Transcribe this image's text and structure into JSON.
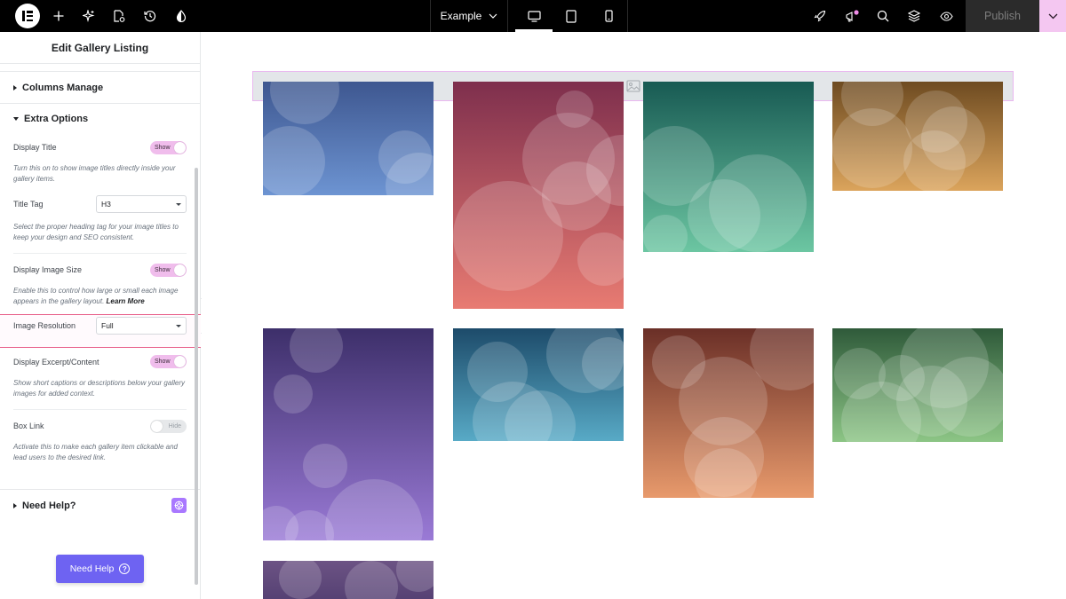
{
  "topbar": {
    "site_name": "Example",
    "publish_label": "Publish",
    "icons": [
      "elementor-logo-icon",
      "plus-icon",
      "sparkle-icon",
      "page-settings-icon",
      "history-icon",
      "theme-style-icon",
      "desktop-icon",
      "tablet-icon",
      "mobile-icon",
      "launch-icon",
      "notifications-icon",
      "search-icon",
      "structure-icon",
      "preview-icon",
      "chevron-down-icon"
    ]
  },
  "panel": {
    "title": "Edit Gallery Listing",
    "sections": {
      "columns": "Columns Manage",
      "extra": "Extra Options",
      "help": "Need Help?"
    },
    "controls": {
      "display_title": {
        "label": "Display Title",
        "state": "Show",
        "desc": "Turn this on to show image titles directly inside your gallery items."
      },
      "title_tag": {
        "label": "Title Tag",
        "value": "H3",
        "desc": "Select the proper heading tag for your image titles to keep your design and SEO consistent."
      },
      "display_image_size": {
        "label": "Display Image Size",
        "state": "Show",
        "desc": "Enable this to control how large or small each image appears in the gallery layout.",
        "link": "Learn More"
      },
      "image_resolution": {
        "label": "Image Resolution",
        "value": "Full"
      },
      "display_excerpt": {
        "label": "Display Excerpt/Content",
        "state": "Show",
        "desc": "Show short captions or descriptions below your gallery images for added context."
      },
      "box_link": {
        "label": "Box Link",
        "state": "Hide",
        "desc": "Activate this to make each gallery item clickable and lead users to the desired link."
      }
    },
    "need_help_button": "Need Help",
    "colors": {
      "accent": "#6e63f2",
      "toggle_on": "#f0bdec",
      "highlight": "#e8608a"
    }
  }
}
